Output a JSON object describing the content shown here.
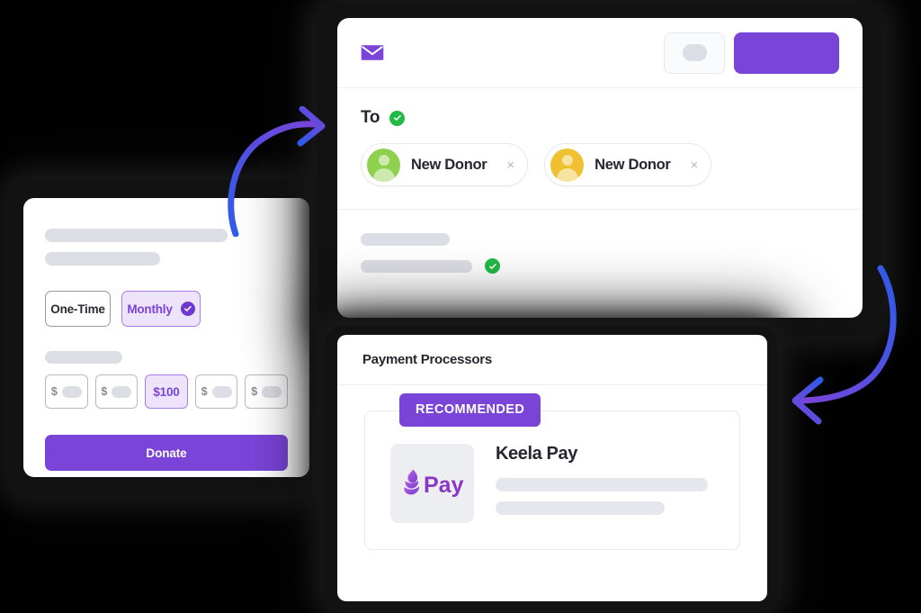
{
  "theme": {
    "background": "#000000",
    "purple": "#7a44d9",
    "purple_light_bg": "#ede4fb",
    "purple_border": "#a97dea",
    "green_check": "#21ba45",
    "skeleton": "#dcdee5",
    "arrow_gradient_from": "#2f5bea",
    "arrow_gradient_to": "#7a44d9"
  },
  "donation_card": {
    "name": "donation-form",
    "frequency_options": [
      {
        "label": "One-Time",
        "selected": false
      },
      {
        "label": "Monthly",
        "selected": true
      }
    ],
    "amount_options": [
      {
        "label": "$",
        "selected": false,
        "placeholder": true
      },
      {
        "label": "$",
        "selected": false,
        "placeholder": true
      },
      {
        "label": "$100",
        "selected": true,
        "placeholder": false
      },
      {
        "label": "$",
        "selected": false,
        "placeholder": true
      },
      {
        "label": "$",
        "selected": false,
        "placeholder": true
      }
    ],
    "donate_button": "Donate"
  },
  "email_card": {
    "header_icon": "envelope-icon",
    "secondary_button_label": "",
    "primary_button_label": "",
    "to_label": "To",
    "to_verified": true,
    "recipients": [
      {
        "name": "New Donor",
        "avatar_color": "#8fd14f",
        "remove_label": "×"
      },
      {
        "name": "New Donor",
        "avatar_color": "#efc02f",
        "remove_label": "×"
      }
    ],
    "footer_verified": true
  },
  "payment_card": {
    "title": "Payment Processors",
    "badge": "RECOMMENDED",
    "processor": {
      "name": "Keela Pay",
      "logo_text": "Pay",
      "logo_icon": "keela-droplet-icon"
    }
  },
  "arrows": [
    {
      "name": "arrow-to-email-card",
      "direction": "up-right"
    },
    {
      "name": "arrow-to-payment-card",
      "direction": "down-left"
    }
  ]
}
